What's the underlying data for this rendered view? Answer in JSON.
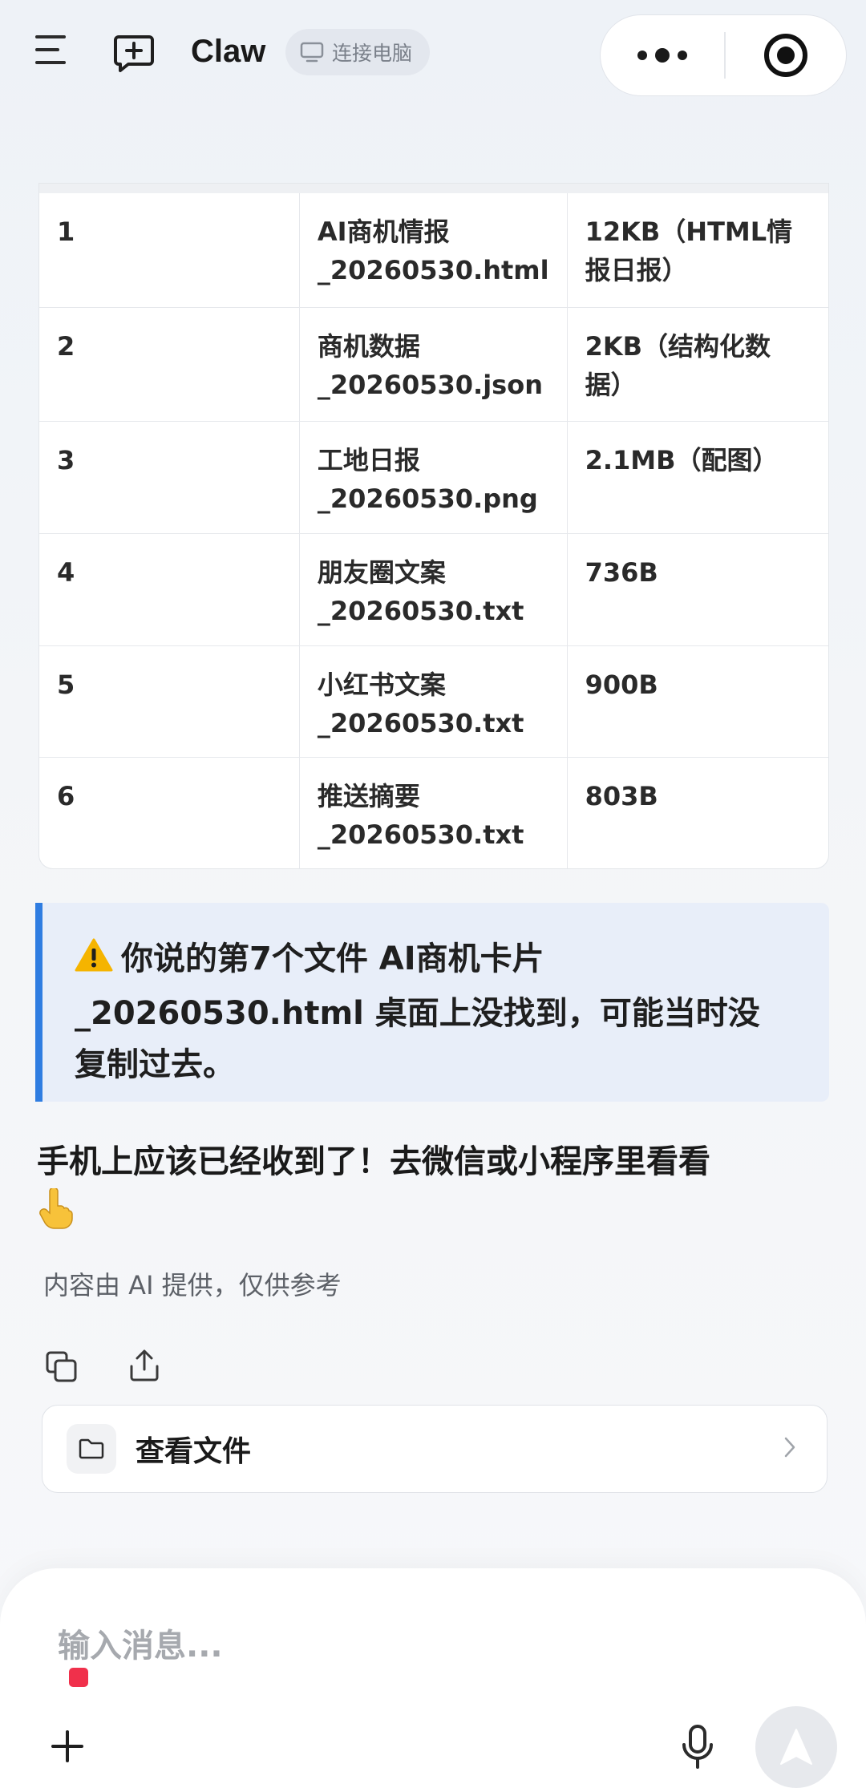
{
  "header": {
    "title": "Claw",
    "connect_label": "连接电脑"
  },
  "files_table": {
    "rows": [
      {
        "index": "1",
        "name": "AI商机情报\n_20260530.html",
        "size": "12KB（HTML情\n报日报）"
      },
      {
        "index": "2",
        "name": "商机数据\n_20260530.json",
        "size": "2KB（结构化数\n据）"
      },
      {
        "index": "3",
        "name": "工地日报\n_20260530.png",
        "size": "2.1MB（配图）"
      },
      {
        "index": "4",
        "name": "朋友圈文案\n_20260530.txt",
        "size": "736B"
      },
      {
        "index": "5",
        "name": "小红书文案\n_20260530.txt",
        "size": "900B"
      },
      {
        "index": "6",
        "name": "推送摘要\n_20260530.txt",
        "size": "803B"
      }
    ]
  },
  "warning": {
    "text_line1": "你说的第7个文件 AI商机卡片",
    "text_line2": "_20260530.html 桌面上没找到，可能当时没",
    "text_line3": "复制过去。"
  },
  "reply": {
    "text": "手机上应该已经收到了！去微信或小程序里看看"
  },
  "disclaimer": "内容由 AI 提供，仅供参考",
  "view_files_label": "查看文件",
  "input": {
    "placeholder": "输入消息..."
  },
  "colors": {
    "accent_blue": "#2f7de1",
    "warning_bg": "#e8eef9",
    "record_red": "#f0304b",
    "warning_icon": "#f5b400"
  },
  "icons": [
    "menu-icon",
    "new-chat-icon",
    "monitor-icon",
    "more-icon",
    "record-icon",
    "warning-icon",
    "pointing-hand-icon",
    "copy-icon",
    "share-icon",
    "folder-icon",
    "chevron-right-icon",
    "plus-icon",
    "mic-icon",
    "send-icon"
  ]
}
